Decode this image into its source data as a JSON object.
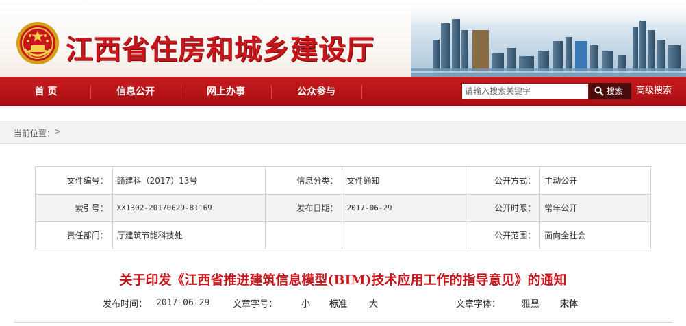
{
  "header": {
    "site_title": "江西省住房和城乡建设厅",
    "brand_color": "#c8161d"
  },
  "nav": {
    "items": [
      {
        "label": "首  页"
      },
      {
        "label": "信息公开"
      },
      {
        "label": "网上办事"
      },
      {
        "label": "公众参与"
      }
    ],
    "search": {
      "placeholder": "请输入搜索关键字",
      "button_label": "搜索",
      "button_icon": "search-icon"
    },
    "advanced_search_label": "高级搜索"
  },
  "breadcrumb": {
    "label": "当前位置：",
    "separator": ">"
  },
  "info_table": {
    "rows": [
      {
        "k1": "文件编号：",
        "v1": "赣建科（2017）13号",
        "k2": "信息分类：",
        "v2": "文件通知",
        "k3": "公开方式：",
        "v3": "主动公开"
      },
      {
        "k1": "索引号：",
        "v1": "XX1302-20170629-81169",
        "k2": "发布日期：",
        "v2": "2017-06-29",
        "k3": "公开时限：",
        "v3": "常年公开"
      },
      {
        "k1": "责任部门：",
        "v1": "厅建筑节能科技处",
        "k2": "",
        "v2": "",
        "k3": "公开范围：",
        "v3": "面向全社会"
      }
    ]
  },
  "article": {
    "title": "关于印发《江西省推进建筑信息模型(BIM)技术应用工作的指导意见》的通知",
    "publish_label": "发布时间：",
    "publish_date": "2017-06-29",
    "font_size_label": "文章字号：",
    "font_size_options": {
      "small": "小",
      "standard": "标准",
      "large": "大"
    },
    "font_face_label": "文章字体：",
    "font_face_options": {
      "yahei": "雅黑",
      "songti": "宋体"
    }
  }
}
